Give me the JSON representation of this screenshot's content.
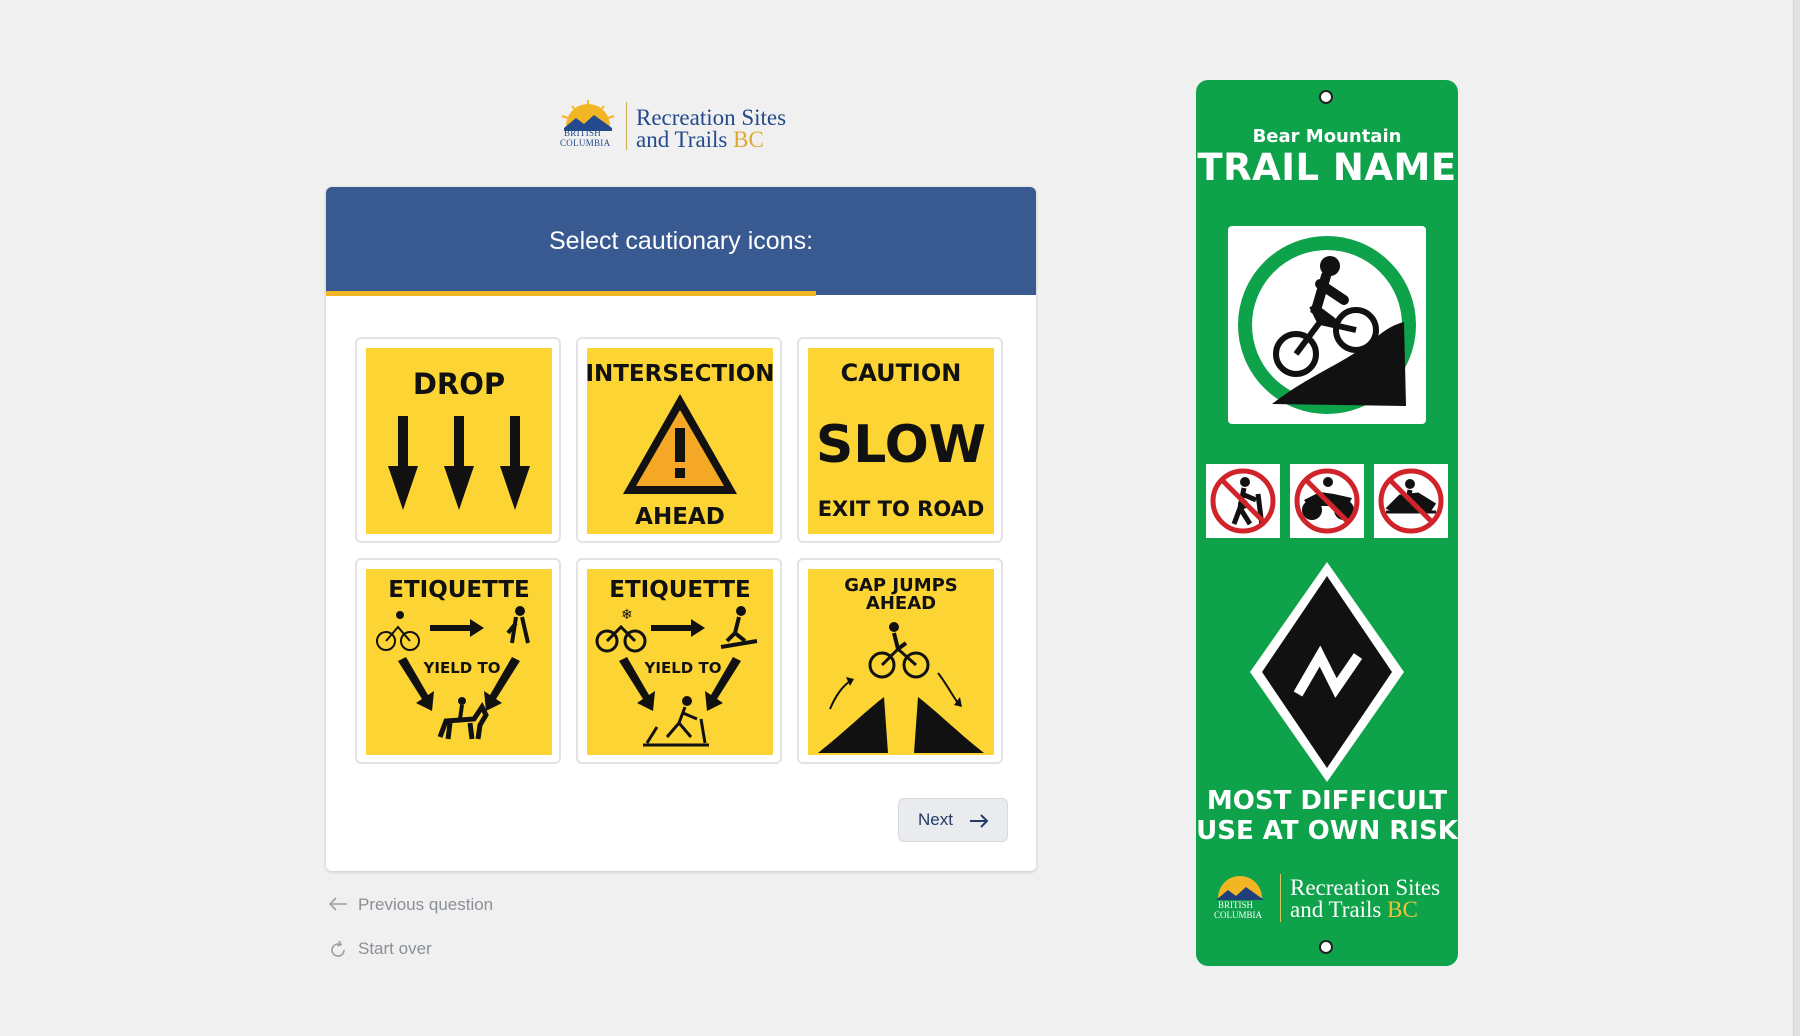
{
  "brand": {
    "line1": "Recreation Sites",
    "line2_a": "and Trails",
    "line2_b": "BC",
    "province_1": "BRITISH",
    "province_2": "COLUMBIA"
  },
  "question": {
    "title": "Select cautionary icons:",
    "progress_fraction": 0.69
  },
  "icons": [
    {
      "label_top": "DROP"
    },
    {
      "label_top": "INTERSECTION",
      "label_bottom": "AHEAD"
    },
    {
      "label_top": "CAUTION",
      "label_mid": "SLOW",
      "label_bottom": "EXIT TO ROAD"
    },
    {
      "label_top": "ETIQUETTE",
      "label_mid": "YIELD TO"
    },
    {
      "label_top": "ETIQUETTE",
      "label_mid": "YIELD TO"
    },
    {
      "label_top": "GAP JUMPS",
      "label_top2": "AHEAD"
    }
  ],
  "nav": {
    "next_label": "Next",
    "previous_label": "Previous question",
    "start_over_label": "Start over"
  },
  "trail_sign": {
    "location": "Bear Mountain",
    "trail_name": "TRAIL NAME",
    "difficulty_1": "MOST DIFFICULT",
    "difficulty_2": "USE AT OWN RISK",
    "activity_icon": "mountain-bike-icon",
    "prohibited_icons": [
      "no-hiking-icon",
      "no-atv-icon",
      "no-snowmobile-icon"
    ],
    "rating_symbol": "black-diamond-icon"
  },
  "colors": {
    "header_blue": "#385a91",
    "progress_gold": "#f2b625",
    "sign_yellow": "#fcd535",
    "trail_green": "#0ea24a"
  }
}
